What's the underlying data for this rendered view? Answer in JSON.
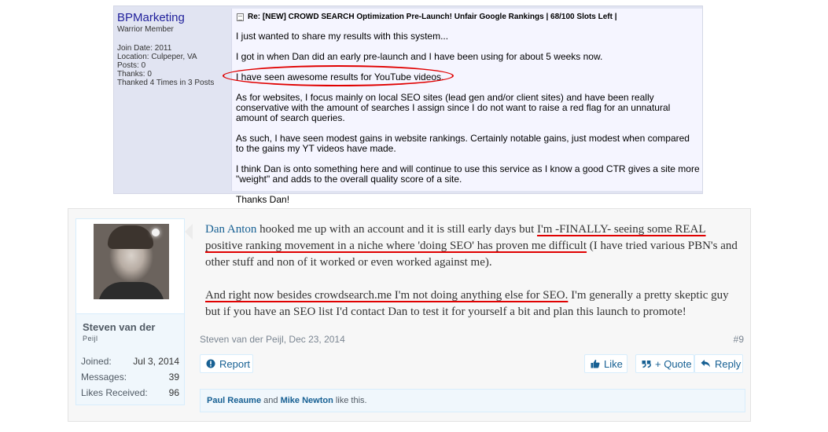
{
  "post1": {
    "username": "BPMarketing",
    "user_title": "Warrior Member",
    "stats": [
      "Join Date: 2011",
      "Location: Culpeper, VA",
      "Posts: 0",
      "Thanks: 0",
      "Thanked 4 Times in 3 Posts"
    ],
    "title": "Re: [NEW] CROWD SEARCH Optimization Pre-Launch! Unfair Google Rankings | 68/100 Slots Left |",
    "paragraphs": [
      "I just wanted to share my results with this system...",
      "I got in when Dan did an early pre-launch and I have been using for about 5 weeks now.",
      "I have seen awesome results for YouTube videos.",
      "As for websites, I focus mainly on local SEO sites (lead gen and/or client sites) and have been really conservative with the amount of searches I assign since I do not want to raise a red flag for an unnatural amount of search queries.",
      "As such, I have seen modest gains in website rankings. Certainly notable gains, just modest when compared to the gains my YT videos have made.",
      "I think Dan is onto something here and will continue to use this service as I know a good CTR gives a site more \"weight\" and adds to the overall quality score of a site.",
      "Thanks Dan!"
    ],
    "highlight_color": "#e00000"
  },
  "post2": {
    "username_line1": "Steven van der",
    "username_line2": "Peijl",
    "stats": [
      {
        "label": "Joined:",
        "value": "Jul 3, 2014"
      },
      {
        "label": "Messages:",
        "value": "39"
      },
      {
        "label": "Likes Received:",
        "value": "96"
      }
    ],
    "message": {
      "link": "Dan Anton",
      "t1": " hooked me up with an account and it is still early days but ",
      "u1": "I'm -FINALLY- seeing some REAL positive ranking movement in a niche where 'doing SEO' has proven me difficult",
      "t2": " (I have tried various PBN's and other stuff and non of it worked or even worked against me).",
      "u2": "And right now besides crowdsearch.me I'm not doing anything else for SEO.",
      "t3": " I'm generally a pretty skeptic guy but if you have an SEO list I'd contact Dan to test it for yourself a bit and plan this launch to promote!"
    },
    "meta": "Steven van der Peijl, Dec 23, 2014",
    "post_number": "#9",
    "buttons": {
      "report": "Report",
      "like": "Like",
      "quote": "+ Quote",
      "reply": "Reply"
    },
    "likes": {
      "user1": "Paul Reaume",
      "and": " and ",
      "user2": "Mike Newton",
      "suffix": " like this."
    },
    "accent_color": "#176093"
  }
}
